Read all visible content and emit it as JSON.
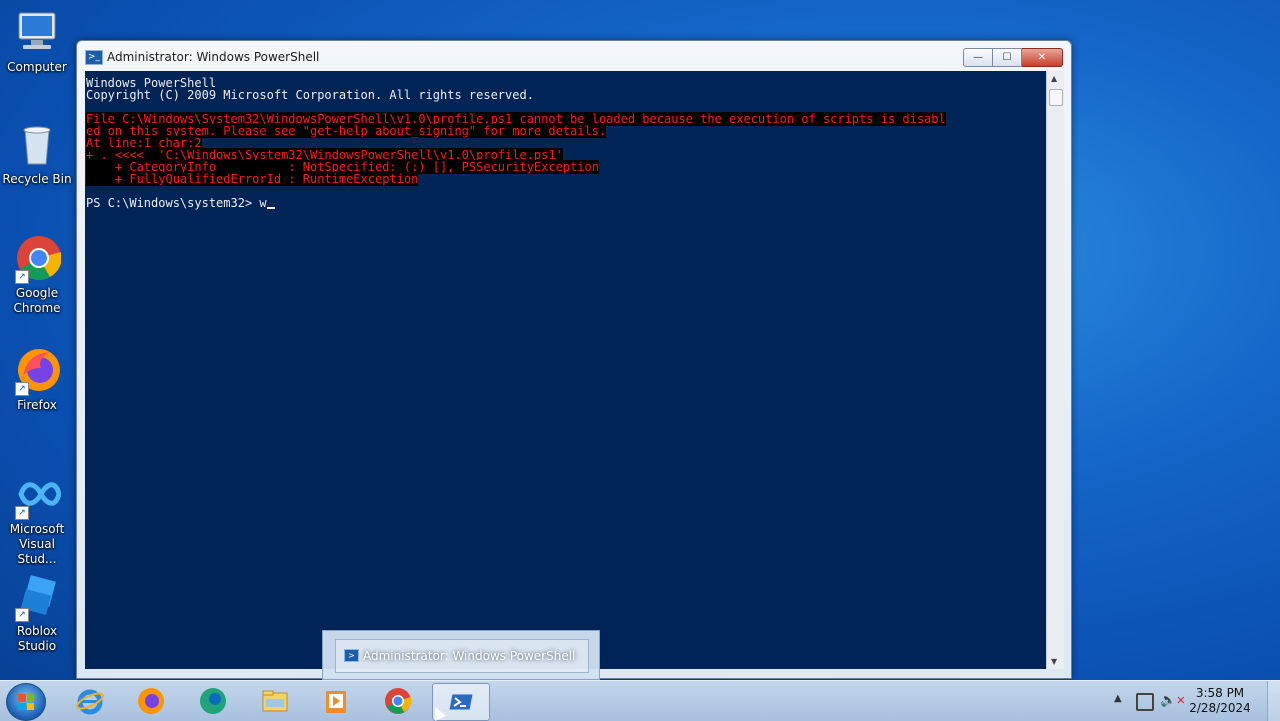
{
  "desktop": {
    "icons": [
      {
        "label": "Computer",
        "icon": "computer-icon"
      },
      {
        "label": "Recycle Bin",
        "icon": "recycle-bin-icon"
      },
      {
        "label": "Google Chrome",
        "icon": "chrome-icon"
      },
      {
        "label": "Firefox",
        "icon": "firefox-icon"
      },
      {
        "label": "Microsoft Visual Stud...",
        "icon": "visual-studio-icon"
      },
      {
        "label": "Roblox Studio",
        "icon": "roblox-studio-icon"
      }
    ]
  },
  "window": {
    "title": "Administrator: Windows PowerShell",
    "minimize": "—",
    "maximize": "☐",
    "close": "✕",
    "console": {
      "lines": [
        {
          "text": "Windows PowerShell",
          "type": "normal"
        },
        {
          "text": "Copyright (C) 2009 Microsoft Corporation. All rights reserved.",
          "type": "normal"
        },
        {
          "text": "",
          "type": "normal"
        },
        {
          "text": "File C:\\Windows\\System32\\WindowsPowerShell\\v1.0\\profile.ps1 cannot be loaded because the execution of scripts is disabl",
          "type": "error"
        },
        {
          "text": "ed on this system. Please see \"get-help about_signing\" for more details.",
          "type": "error"
        },
        {
          "text": "At line:1 char:2",
          "type": "error"
        },
        {
          "text": "+ . <<<<  'C:\\Windows\\System32\\WindowsPowerShell\\v1.0\\profile.ps1'",
          "type": "error"
        },
        {
          "text": "    + CategoryInfo          : NotSpecified: (:) [], PSSecurityException",
          "type": "error"
        },
        {
          "text": "    + FullyQualifiedErrorId : RuntimeException",
          "type": "error"
        },
        {
          "text": "",
          "type": "normal"
        }
      ],
      "prompt": "PS C:\\Windows\\system32> ",
      "input": "w"
    }
  },
  "preview": {
    "label": "Administrator: Windows PowerShell"
  },
  "taskbar": {
    "items": [
      {
        "name": "internet-explorer",
        "active": false
      },
      {
        "name": "firefox",
        "active": false
      },
      {
        "name": "edge",
        "active": false
      },
      {
        "name": "file-explorer",
        "active": false
      },
      {
        "name": "media-player",
        "active": false
      },
      {
        "name": "chrome",
        "active": false
      },
      {
        "name": "powershell",
        "active": true
      }
    ],
    "time": "3:58 PM",
    "date": "2/28/2024"
  },
  "colors": {
    "console_bg": "#012456",
    "error_fg": "#ff1a1a",
    "error_bg": "#000000"
  }
}
